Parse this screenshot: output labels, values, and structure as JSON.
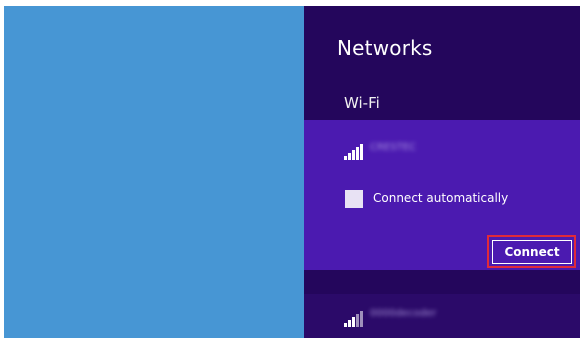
{
  "networks_pane": {
    "title": "Networks",
    "section_label": "Wi-Fi",
    "accent_color": "#24065c",
    "selected_color": "#4b1ab0"
  },
  "networks": [
    {
      "ssid": "CRESTEC",
      "icon": "wifi-signal-icon",
      "expanded": true,
      "auto_connect_label": "Connect automatically",
      "auto_connect_checked": false,
      "connect_label": "Connect"
    },
    {
      "ssid": "0000decoder",
      "icon": "wifi-signal-icon",
      "expanded": false
    }
  ],
  "annotation": {
    "highlight_color": "#e02a3a"
  }
}
